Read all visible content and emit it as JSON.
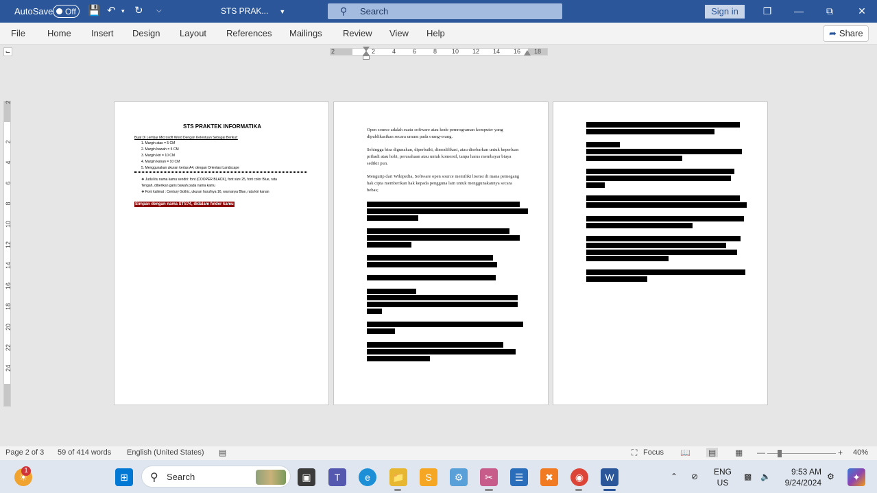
{
  "titlebar": {
    "autosave_label": "AutoSave",
    "autosave_state": "Off",
    "doc_title": "STS PRAK...",
    "search_placeholder": "Search",
    "signin_label": "Sign in"
  },
  "menu": {
    "items": [
      "File",
      "Home",
      "Insert",
      "Design",
      "Layout",
      "References",
      "Mailings",
      "Review",
      "View",
      "Help"
    ],
    "share_label": "Share"
  },
  "ruler": {
    "h_numbers": [
      "2",
      "2",
      "4",
      "6",
      "8",
      "10",
      "12",
      "14",
      "16",
      "18"
    ],
    "v_numbers": [
      "2",
      "2",
      "4",
      "6",
      "8",
      "10",
      "12",
      "14",
      "16",
      "18",
      "20",
      "22",
      "24"
    ]
  },
  "page1": {
    "title": "STS PRAKTEK INFORMATIKA",
    "subtitle": "Buat Di Lembar Microsoft Word Dengan Ketentuan Sebagai Berikut:",
    "list": [
      "1.    Margin atas      = 5 CM",
      "2.    Margin bawah = 5 CM",
      "3.    Margin kiri      = 10 CM",
      "4.    Margin kanan  = 10 CM",
      "5.    Menggunakan ukuran kertas A4, dengan Orientasi Landscape"
    ],
    "bullets": [
      "❖   Judul itu nama kamu sendiri: font (COOPER BLACK), font size 25, font color Blue, rata",
      "      Tengah, diberikan garis bawah pada nama kamu",
      "❖   Font kalimat    : Century Gothic, ukuran hurufnya 16, warnanya Blue, rata kiri kanan"
    ],
    "save_note": "Simpan dengan nama STS74, didalam folder kamu"
  },
  "page2": {
    "paragraphs": [
      "Open source adalah suatu software atau kode pemrograman komputer yang dipublikasikan secara umum pada orang-orang.",
      "Sehingga bisa digunakan, diperbaiki, dimodifikasi, atau disebarkan untuk keperluan pribadi atau hobi, perusahaan atau untuk komersil, tanpa harus membayar biaya sedikit pun.",
      "Mengutip dari Wikipedia, Software open source memiliki lisensi di mana pemegang hak cipta memberikan hak kepada pengguna lain untuk menggunakannya secara bebas;"
    ]
  },
  "statusbar": {
    "page": "Page 2 of 3",
    "words": "59 of 414 words",
    "language": "English (United States)",
    "focus_label": "Focus",
    "zoom": "40%"
  },
  "taskbar": {
    "search_label": "Search",
    "notification_count": "1",
    "lang_line1": "ENG",
    "lang_line2": "US",
    "time": "9:53 AM",
    "date": "9/24/2024"
  }
}
